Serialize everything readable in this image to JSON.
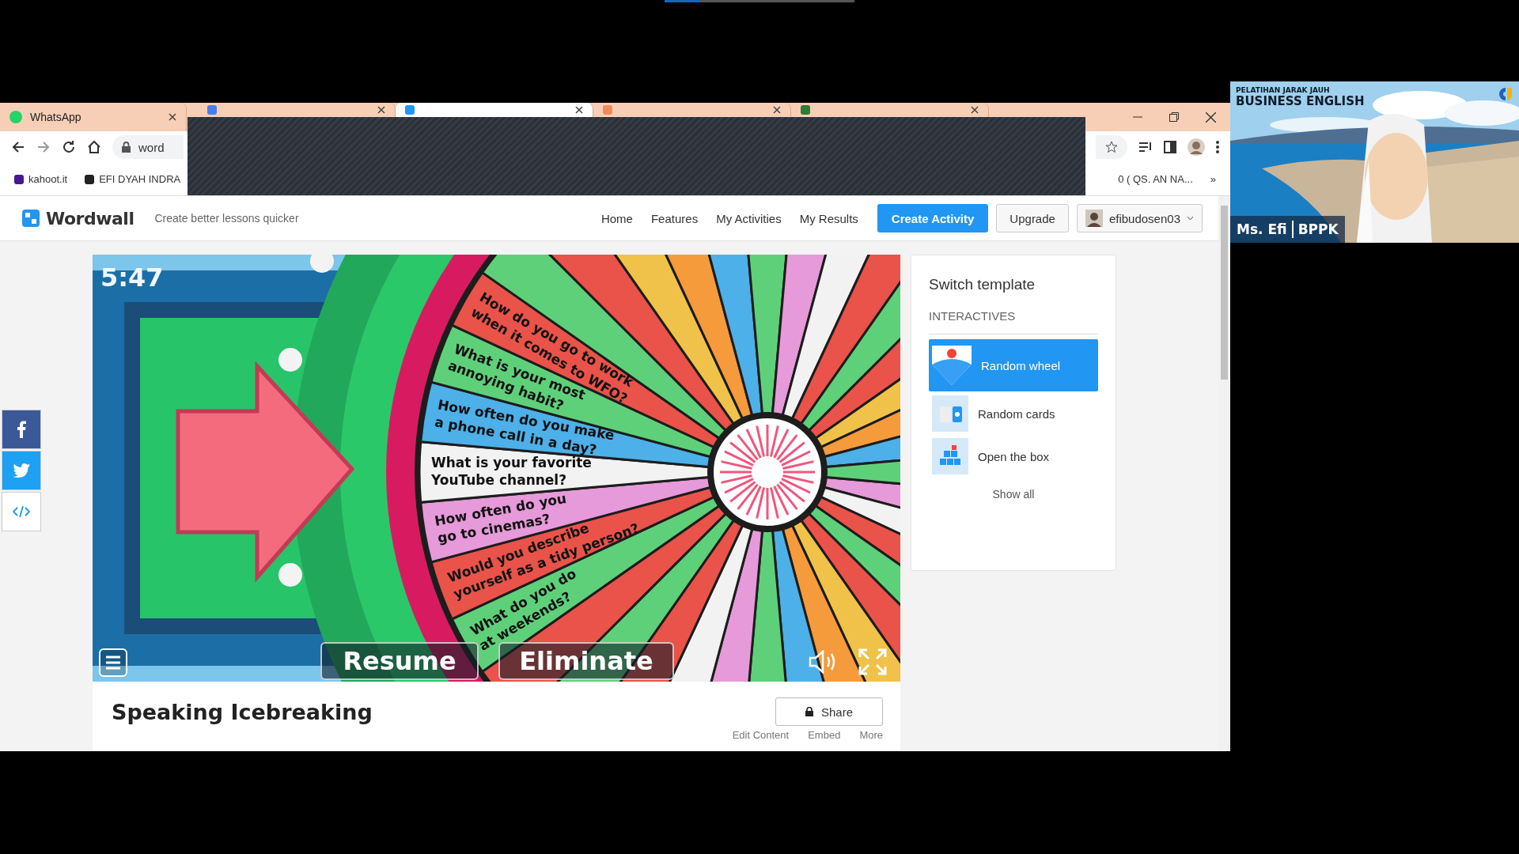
{
  "browser": {
    "tabs": [
      {
        "title": "WhatsApp",
        "selected": false,
        "color": "#25d366"
      },
      {
        "selected": false,
        "color": "#4a7df0"
      },
      {
        "selected": true,
        "color": "#2196f3"
      },
      {
        "selected": false,
        "color": "#f08a5d"
      },
      {
        "selected": false,
        "color": "#2e7d32"
      }
    ],
    "address": {
      "value": "word"
    },
    "bookmarks": [
      {
        "label": "kahoot.it",
        "color": "#46178f"
      },
      {
        "label": "EFI DYAH INDRA",
        "color": "#222222"
      }
    ],
    "bookmark_right": "0 ( QS. AN NA...",
    "bookmarks_more": "»"
  },
  "site": {
    "brand": "Wordwall",
    "tagline": "Create better lessons quicker",
    "nav": [
      "Home",
      "Features",
      "My Activities",
      "My Results"
    ],
    "create_button": "Create Activity",
    "upgrade_button": "Upgrade",
    "user": "efibudosen03"
  },
  "game": {
    "timer": "5:47",
    "questions": [
      {
        "lines": [
          "How do you go to work",
          "when it comes to WFO?"
        ],
        "color": "#e9534a"
      },
      {
        "lines": [
          "What is your most",
          "annoying habit?"
        ],
        "color": "#5fd07a"
      },
      {
        "lines": [
          "How often do you make",
          "a phone call in a day?"
        ],
        "color": "#4db0e8"
      },
      {
        "lines": [
          "What is your favorite",
          "YouTube channel?"
        ],
        "color": "#f2f2f2"
      },
      {
        "lines": [
          "How often do you",
          "go to cinemas?"
        ],
        "color": "#e69ad9"
      },
      {
        "lines": [
          "Would you describe",
          "yourself as a tidy person?"
        ],
        "color": "#e9534a"
      },
      {
        "lines": [
          "What do you do",
          "at weekends?"
        ],
        "color": "#5fd07a"
      }
    ],
    "buttons": [
      "Resume",
      "Eliminate"
    ]
  },
  "activity": {
    "title": "Speaking Icebreaking",
    "share": "Share",
    "links": [
      "Edit Content",
      "Embed",
      "More"
    ]
  },
  "template_panel": {
    "title": "Switch template",
    "section": "INTERACTIVES",
    "items": [
      {
        "label": "Random wheel",
        "selected": true,
        "kind": "wheel"
      },
      {
        "label": "Random cards",
        "selected": false,
        "kind": "cards"
      },
      {
        "label": "Open the box",
        "selected": false,
        "kind": "boxes"
      }
    ],
    "show_all": "Show all"
  },
  "video": {
    "course_line1": "PELATIHAN JARAK JAUH",
    "course_line2": "BUSINESS ENGLISH",
    "speaker": "Ms. Efi",
    "org": "BPPK"
  }
}
